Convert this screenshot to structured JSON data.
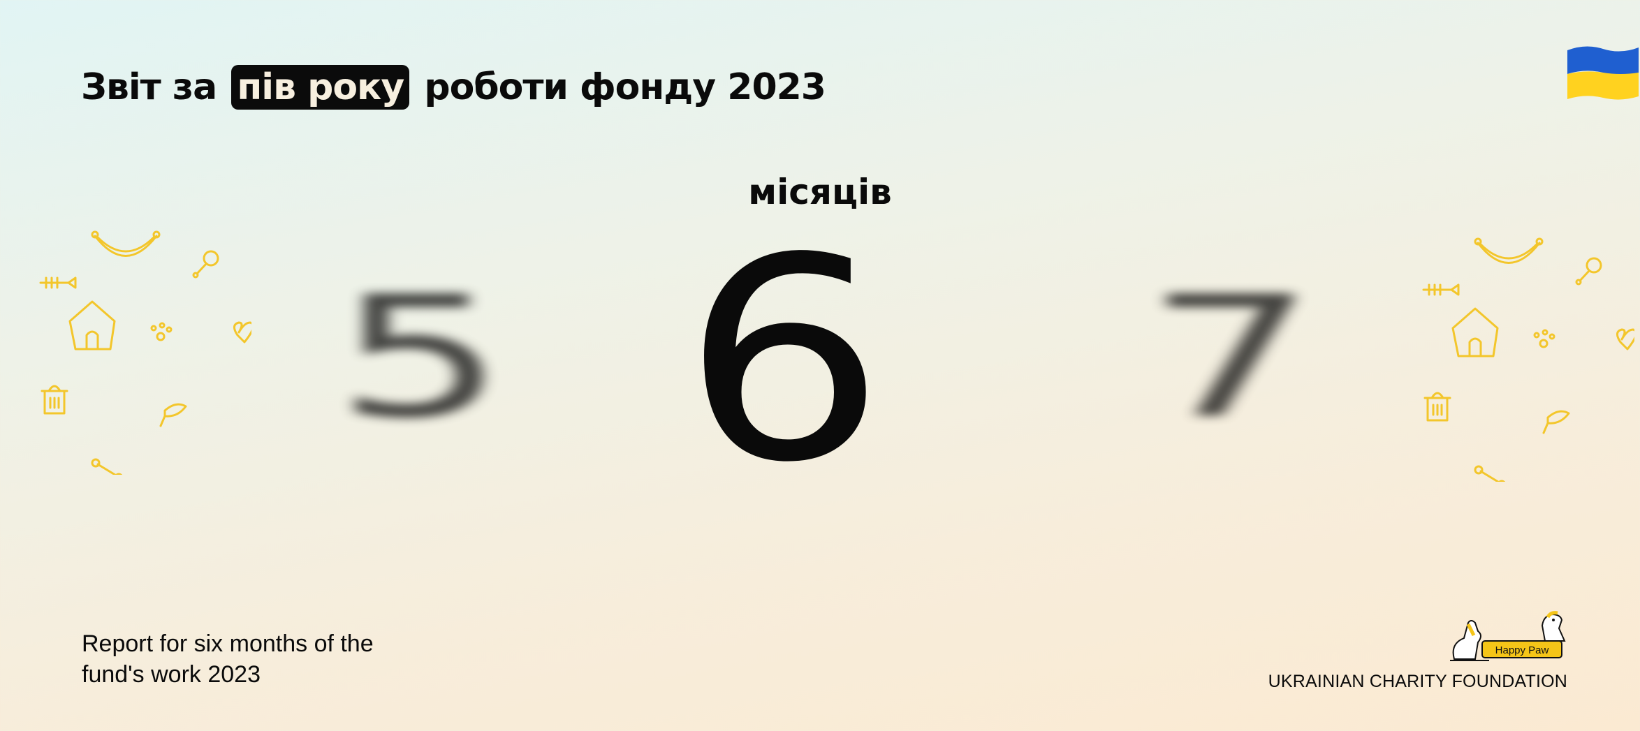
{
  "header": {
    "title_before": "Звіт за",
    "title_highlight": "пів року",
    "title_after": "роботи фонду 2023"
  },
  "counter": {
    "label": "місяців",
    "previous": "5",
    "current": "6",
    "next": "7"
  },
  "footer": {
    "subtitle_line1": "Report for six months of the",
    "subtitle_line2": "fund's work 2023",
    "logo_text": "Happy Paw",
    "organization": "UKRAINIAN CHARITY FOUNDATION"
  },
  "colors": {
    "accent_yellow": "#f5c518",
    "flag_blue": "#1f5fd0",
    "flag_yellow": "#ffd21f",
    "text": "#0a0a0a"
  },
  "icons": [
    "flag-ukraine-icon",
    "sausage-icon",
    "drumstick-icon",
    "fishbone-icon",
    "doghouse-icon",
    "paw-icon",
    "heart-icon",
    "hydrant-icon",
    "fish-icon",
    "bone-icon",
    "happy-paw-logo"
  ]
}
